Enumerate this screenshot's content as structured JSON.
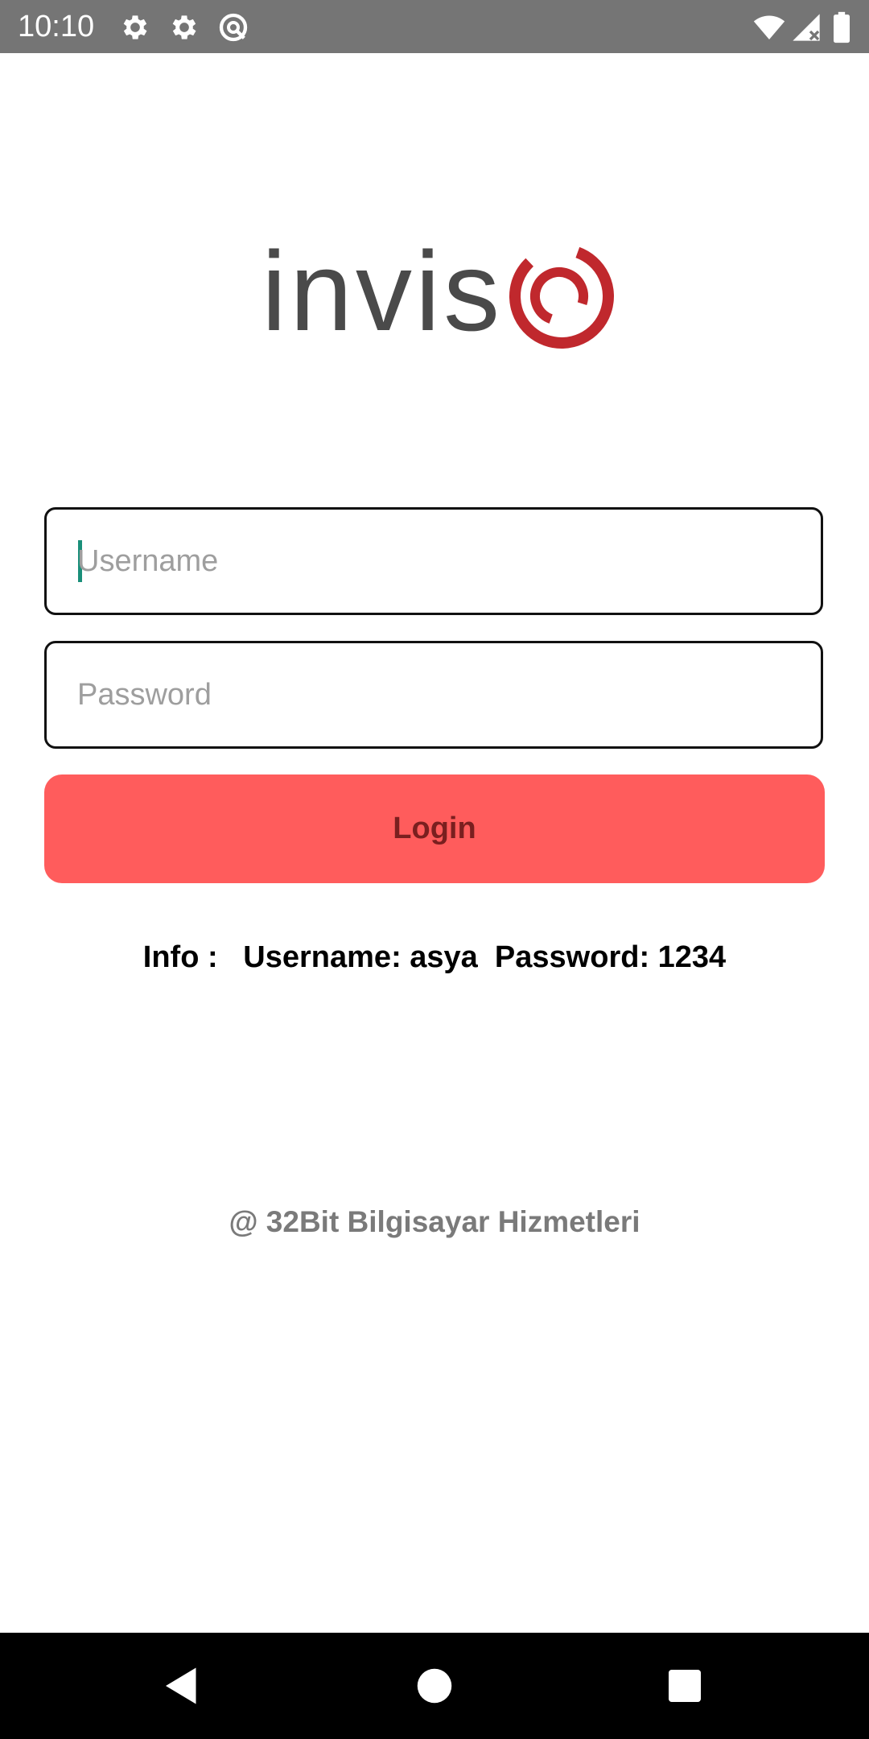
{
  "status_bar": {
    "time": "10:10",
    "left_icons": [
      "settings-icon",
      "settings-icon",
      "at-sign-icon"
    ],
    "right_icons": [
      "wifi-icon",
      "signal-icon",
      "battery-icon"
    ]
  },
  "logo": {
    "text": "inviso",
    "text_color": "#4a4a4a",
    "accent_color": "#c0282d"
  },
  "form": {
    "username_placeholder": "Username",
    "username_value": "",
    "password_placeholder": "Password",
    "password_value": "",
    "login_label": "Login"
  },
  "info": {
    "text": "Info :   Username: asya  Password: 1234"
  },
  "footer": {
    "copyright": "@ 32Bit Bilgisayar Hizmetleri"
  },
  "nav_bar": {
    "buttons": [
      "back-icon",
      "home-icon",
      "recents-icon"
    ]
  },
  "colors": {
    "status_bar_bg": "#757575",
    "button_bg": "#ff5c5c",
    "button_text": "#7a1f1f",
    "caret": "#1a8f7a"
  }
}
